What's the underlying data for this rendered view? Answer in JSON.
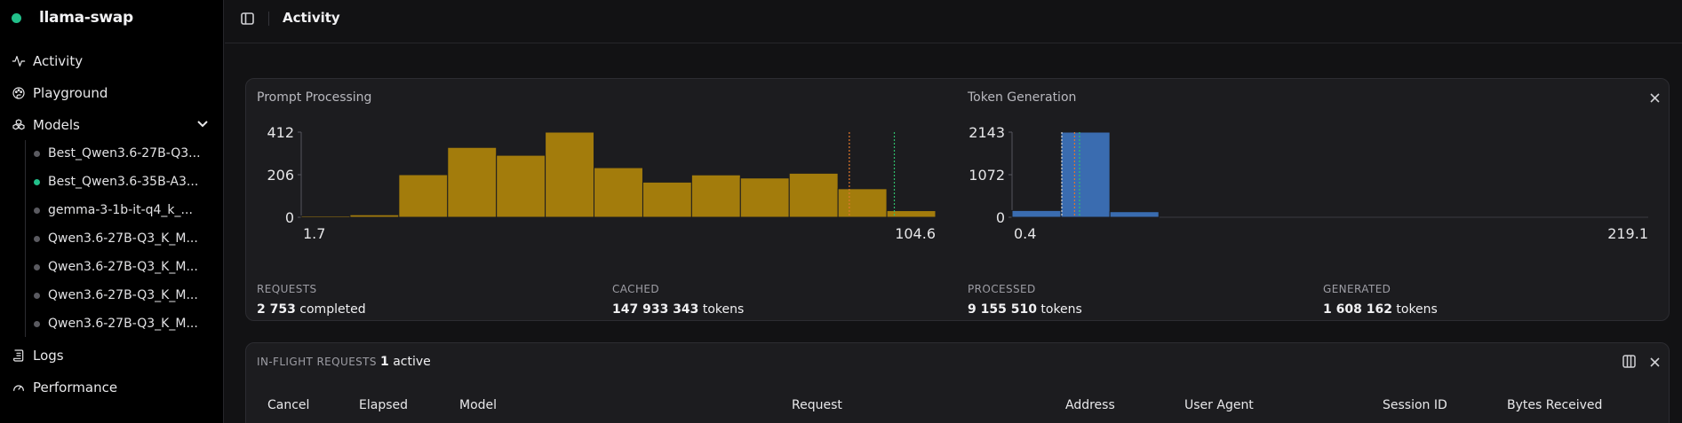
{
  "app": {
    "name": "llama-swap"
  },
  "sidebar": {
    "nav": [
      {
        "label": "Activity",
        "icon": "activity-icon"
      },
      {
        "label": "Playground",
        "icon": "palette-icon"
      },
      {
        "label": "Models",
        "icon": "boxes-icon"
      },
      {
        "label": "Logs",
        "icon": "scroll-icon"
      },
      {
        "label": "Performance",
        "icon": "gauge-icon"
      }
    ],
    "models": [
      {
        "label": "Best_Qwen3.6-27B-Q3...",
        "active": false
      },
      {
        "label": "Best_Qwen3.6-35B-A3...",
        "active": true
      },
      {
        "label": "gemma-3-1b-it-q4_k_...",
        "active": false
      },
      {
        "label": "Qwen3.6-27B-Q3_K_M...",
        "active": false
      },
      {
        "label": "Qwen3.6-27B-Q3_K_M...",
        "active": false
      },
      {
        "label": "Qwen3.6-27B-Q3_K_M...",
        "active": false
      },
      {
        "label": "Qwen3.6-27B-Q3_K_M...",
        "active": false
      }
    ]
  },
  "header": {
    "title": "Activity"
  },
  "stats": {
    "prompt_title": "Prompt Processing",
    "token_title": "Token Generation",
    "requests": {
      "label": "REQUESTS",
      "value": "2 753",
      "suffix": "completed"
    },
    "cached": {
      "label": "CACHED",
      "value": "147 933 343",
      "suffix": "tokens"
    },
    "processed": {
      "label": "PROCESSED",
      "value": "9 155 510",
      "suffix": "tokens"
    },
    "generated": {
      "label": "GENERATED",
      "value": "1 608 162",
      "suffix": "tokens"
    }
  },
  "inflight": {
    "label": "IN-FLIGHT REQUESTS",
    "count": "1",
    "count_suffix": "active",
    "columns": [
      "Cancel",
      "Elapsed",
      "Model",
      "Request",
      "Address",
      "User Agent",
      "Session ID",
      "Bytes Received"
    ]
  },
  "colors": {
    "prompt_bar": "#a37c0c",
    "token_bar": "#3a6cb0",
    "marker_orange": "#e0772c",
    "marker_green": "#2fbf6c",
    "marker_white": "#d8d8d8",
    "brand_dot": "#22c08a"
  },
  "chart_data": [
    {
      "type": "bar",
      "title": "Prompt Processing",
      "x_min_label": "1.7",
      "x_max_label": "104.6",
      "x_range": [
        1.7,
        104.6
      ],
      "y_ticks": [
        "412",
        "206",
        "0"
      ],
      "ylim": [
        0,
        412
      ],
      "values": [
        6,
        12,
        206,
        338,
        300,
        412,
        240,
        170,
        205,
        190,
        213,
        138,
        32
      ],
      "markers": [
        {
          "color": "orange",
          "x": 90.6
        },
        {
          "color": "green",
          "x": 97.9
        }
      ]
    },
    {
      "type": "bar",
      "title": "Token Generation",
      "x_min_label": "0.4",
      "x_max_label": "219.1",
      "x_range": [
        0.4,
        219.1
      ],
      "y_ticks": [
        "2143",
        "1072",
        "0"
      ],
      "ylim": [
        0,
        2143
      ],
      "values": [
        170,
        2143,
        140,
        0,
        0,
        0,
        0,
        0,
        0,
        0,
        0,
        0,
        0
      ],
      "markers": [
        {
          "color": "white",
          "x": 17.5
        },
        {
          "color": "orange",
          "x": 21.9
        },
        {
          "color": "green",
          "x": 23.6
        }
      ]
    }
  ]
}
